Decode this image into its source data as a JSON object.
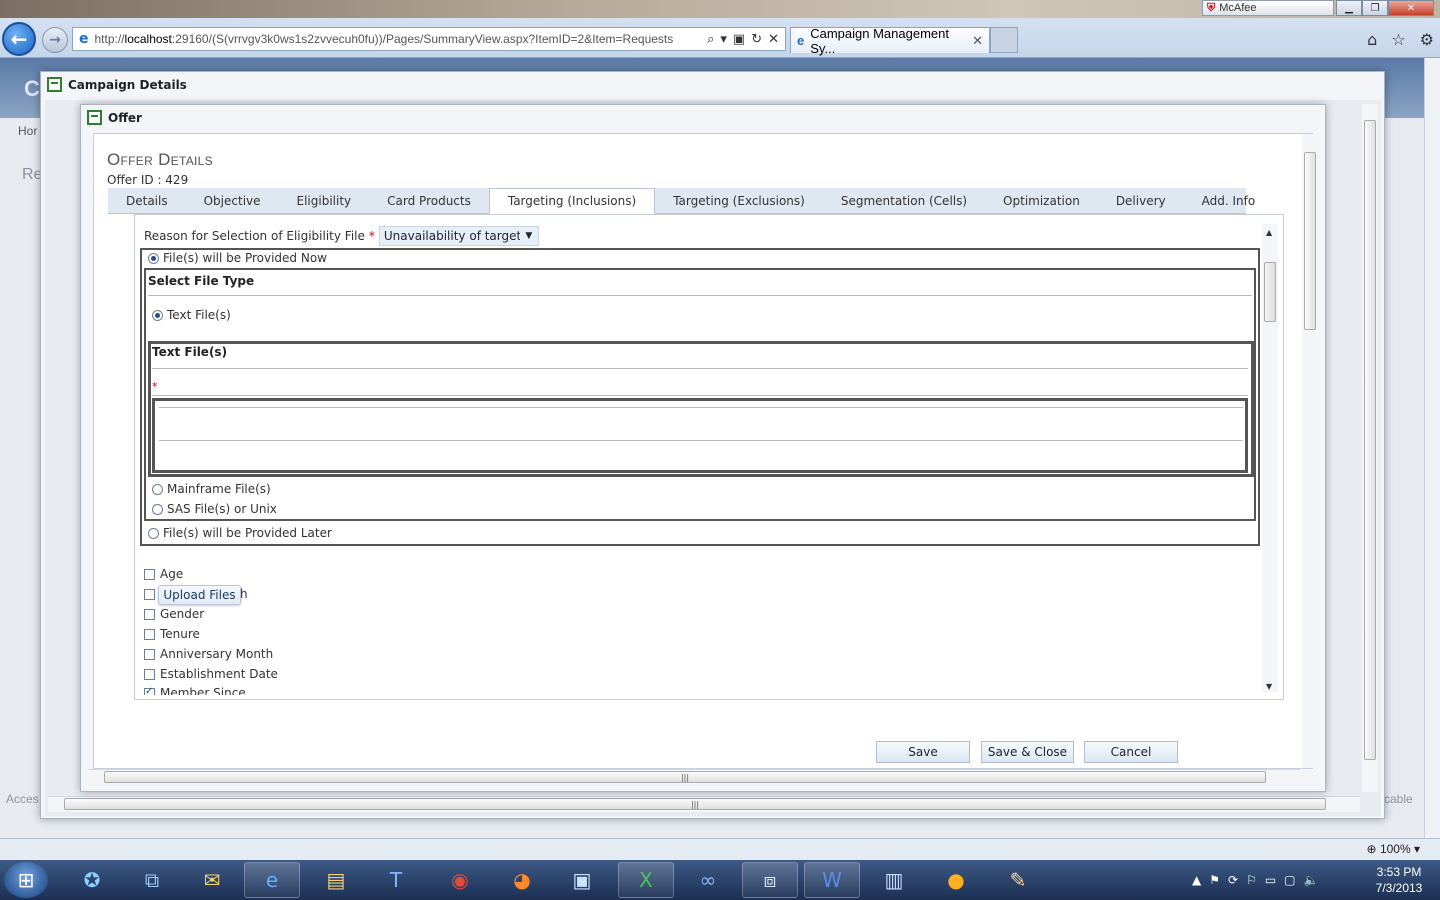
{
  "browser": {
    "url_prefix": "http://",
    "url_host": "localhost",
    "url_rest": ":29160/(S(vrrvgv3k0ws1s2zvvecuh0fu))/Pages/SummaryView.aspx?ItemID=2&Item=Requests",
    "tab_title": "Campaign Management Sy...",
    "addon_label": "McAfee",
    "zoom": "100%"
  },
  "background_page": {
    "text_1": "C",
    "text_2": "Hor",
    "text_3": "C",
    "text_4": "Re",
    "text_5": "Acces",
    "text_6": "cable"
  },
  "campaign_modal": {
    "title": "Campaign Details"
  },
  "offer_modal": {
    "title": "Offer",
    "heading": "Offer Details",
    "offer_id": "Offer ID : 429"
  },
  "tabs": [
    {
      "label": "Details",
      "active": false
    },
    {
      "label": "Objective",
      "active": false
    },
    {
      "label": "Eligibility",
      "active": false
    },
    {
      "label": "Card Products",
      "active": false
    },
    {
      "label": "Targeting (Inclusions)",
      "active": true
    },
    {
      "label": "Targeting (Exclusions)",
      "active": false
    },
    {
      "label": "Segmentation (Cells)",
      "active": false
    },
    {
      "label": "Optimization",
      "active": false
    },
    {
      "label": "Delivery",
      "active": false
    },
    {
      "label": "Add. Info",
      "active": false
    }
  ],
  "form": {
    "reason_label": "Reason for Selection of Eligibility File",
    "required_mark": "*",
    "reason_value": "Unavailability of targeting",
    "provided_now": "File(s) will be Provided Now",
    "select_file_type": "Select File Type",
    "text_files_option": "Text File(s)",
    "text_files_heading": "Text File(s)",
    "mainframe_option": "Mainframe File(s)",
    "sas_option": "SAS File(s) or Unix",
    "provided_later": "File(s) will be Provided Later",
    "upload_button": "Upload Files",
    "checkboxes": [
      {
        "label": "Age",
        "checked": false
      },
      {
        "label": "h",
        "checked": false
      },
      {
        "label": "Gender",
        "checked": false
      },
      {
        "label": "Tenure",
        "checked": false
      },
      {
        "label": "Anniversary Month",
        "checked": false
      },
      {
        "label": "Establishment Date",
        "checked": false
      },
      {
        "label": "Member Since",
        "checked": true
      }
    ]
  },
  "actions": {
    "save": "Save",
    "save_close": "Save & Close",
    "cancel": "Cancel"
  },
  "taskbar": {
    "time": "3:53 PM",
    "date": "7/3/2013"
  }
}
